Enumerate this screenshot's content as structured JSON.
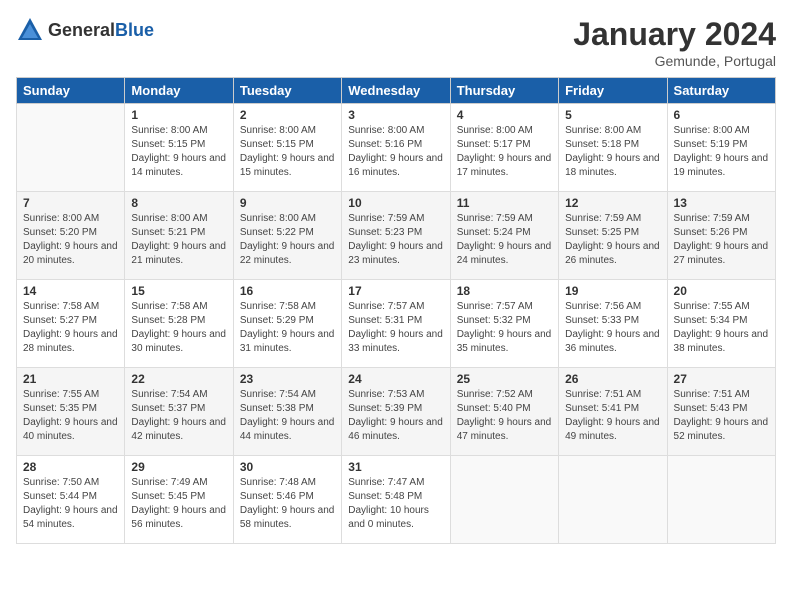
{
  "logo": {
    "general": "General",
    "blue": "Blue"
  },
  "title": "January 2024",
  "location": "Gemunde, Portugal",
  "days_of_week": [
    "Sunday",
    "Monday",
    "Tuesday",
    "Wednesday",
    "Thursday",
    "Friday",
    "Saturday"
  ],
  "weeks": [
    [
      {
        "num": "",
        "sunrise": "",
        "sunset": "",
        "daylight": ""
      },
      {
        "num": "1",
        "sunrise": "Sunrise: 8:00 AM",
        "sunset": "Sunset: 5:15 PM",
        "daylight": "Daylight: 9 hours and 14 minutes."
      },
      {
        "num": "2",
        "sunrise": "Sunrise: 8:00 AM",
        "sunset": "Sunset: 5:15 PM",
        "daylight": "Daylight: 9 hours and 15 minutes."
      },
      {
        "num": "3",
        "sunrise": "Sunrise: 8:00 AM",
        "sunset": "Sunset: 5:16 PM",
        "daylight": "Daylight: 9 hours and 16 minutes."
      },
      {
        "num": "4",
        "sunrise": "Sunrise: 8:00 AM",
        "sunset": "Sunset: 5:17 PM",
        "daylight": "Daylight: 9 hours and 17 minutes."
      },
      {
        "num": "5",
        "sunrise": "Sunrise: 8:00 AM",
        "sunset": "Sunset: 5:18 PM",
        "daylight": "Daylight: 9 hours and 18 minutes."
      },
      {
        "num": "6",
        "sunrise": "Sunrise: 8:00 AM",
        "sunset": "Sunset: 5:19 PM",
        "daylight": "Daylight: 9 hours and 19 minutes."
      }
    ],
    [
      {
        "num": "7",
        "sunrise": "Sunrise: 8:00 AM",
        "sunset": "Sunset: 5:20 PM",
        "daylight": "Daylight: 9 hours and 20 minutes."
      },
      {
        "num": "8",
        "sunrise": "Sunrise: 8:00 AM",
        "sunset": "Sunset: 5:21 PM",
        "daylight": "Daylight: 9 hours and 21 minutes."
      },
      {
        "num": "9",
        "sunrise": "Sunrise: 8:00 AM",
        "sunset": "Sunset: 5:22 PM",
        "daylight": "Daylight: 9 hours and 22 minutes."
      },
      {
        "num": "10",
        "sunrise": "Sunrise: 7:59 AM",
        "sunset": "Sunset: 5:23 PM",
        "daylight": "Daylight: 9 hours and 23 minutes."
      },
      {
        "num": "11",
        "sunrise": "Sunrise: 7:59 AM",
        "sunset": "Sunset: 5:24 PM",
        "daylight": "Daylight: 9 hours and 24 minutes."
      },
      {
        "num": "12",
        "sunrise": "Sunrise: 7:59 AM",
        "sunset": "Sunset: 5:25 PM",
        "daylight": "Daylight: 9 hours and 26 minutes."
      },
      {
        "num": "13",
        "sunrise": "Sunrise: 7:59 AM",
        "sunset": "Sunset: 5:26 PM",
        "daylight": "Daylight: 9 hours and 27 minutes."
      }
    ],
    [
      {
        "num": "14",
        "sunrise": "Sunrise: 7:58 AM",
        "sunset": "Sunset: 5:27 PM",
        "daylight": "Daylight: 9 hours and 28 minutes."
      },
      {
        "num": "15",
        "sunrise": "Sunrise: 7:58 AM",
        "sunset": "Sunset: 5:28 PM",
        "daylight": "Daylight: 9 hours and 30 minutes."
      },
      {
        "num": "16",
        "sunrise": "Sunrise: 7:58 AM",
        "sunset": "Sunset: 5:29 PM",
        "daylight": "Daylight: 9 hours and 31 minutes."
      },
      {
        "num": "17",
        "sunrise": "Sunrise: 7:57 AM",
        "sunset": "Sunset: 5:31 PM",
        "daylight": "Daylight: 9 hours and 33 minutes."
      },
      {
        "num": "18",
        "sunrise": "Sunrise: 7:57 AM",
        "sunset": "Sunset: 5:32 PM",
        "daylight": "Daylight: 9 hours and 35 minutes."
      },
      {
        "num": "19",
        "sunrise": "Sunrise: 7:56 AM",
        "sunset": "Sunset: 5:33 PM",
        "daylight": "Daylight: 9 hours and 36 minutes."
      },
      {
        "num": "20",
        "sunrise": "Sunrise: 7:55 AM",
        "sunset": "Sunset: 5:34 PM",
        "daylight": "Daylight: 9 hours and 38 minutes."
      }
    ],
    [
      {
        "num": "21",
        "sunrise": "Sunrise: 7:55 AM",
        "sunset": "Sunset: 5:35 PM",
        "daylight": "Daylight: 9 hours and 40 minutes."
      },
      {
        "num": "22",
        "sunrise": "Sunrise: 7:54 AM",
        "sunset": "Sunset: 5:37 PM",
        "daylight": "Daylight: 9 hours and 42 minutes."
      },
      {
        "num": "23",
        "sunrise": "Sunrise: 7:54 AM",
        "sunset": "Sunset: 5:38 PM",
        "daylight": "Daylight: 9 hours and 44 minutes."
      },
      {
        "num": "24",
        "sunrise": "Sunrise: 7:53 AM",
        "sunset": "Sunset: 5:39 PM",
        "daylight": "Daylight: 9 hours and 46 minutes."
      },
      {
        "num": "25",
        "sunrise": "Sunrise: 7:52 AM",
        "sunset": "Sunset: 5:40 PM",
        "daylight": "Daylight: 9 hours and 47 minutes."
      },
      {
        "num": "26",
        "sunrise": "Sunrise: 7:51 AM",
        "sunset": "Sunset: 5:41 PM",
        "daylight": "Daylight: 9 hours and 49 minutes."
      },
      {
        "num": "27",
        "sunrise": "Sunrise: 7:51 AM",
        "sunset": "Sunset: 5:43 PM",
        "daylight": "Daylight: 9 hours and 52 minutes."
      }
    ],
    [
      {
        "num": "28",
        "sunrise": "Sunrise: 7:50 AM",
        "sunset": "Sunset: 5:44 PM",
        "daylight": "Daylight: 9 hours and 54 minutes."
      },
      {
        "num": "29",
        "sunrise": "Sunrise: 7:49 AM",
        "sunset": "Sunset: 5:45 PM",
        "daylight": "Daylight: 9 hours and 56 minutes."
      },
      {
        "num": "30",
        "sunrise": "Sunrise: 7:48 AM",
        "sunset": "Sunset: 5:46 PM",
        "daylight": "Daylight: 9 hours and 58 minutes."
      },
      {
        "num": "31",
        "sunrise": "Sunrise: 7:47 AM",
        "sunset": "Sunset: 5:48 PM",
        "daylight": "Daylight: 10 hours and 0 minutes."
      },
      {
        "num": "",
        "sunrise": "",
        "sunset": "",
        "daylight": ""
      },
      {
        "num": "",
        "sunrise": "",
        "sunset": "",
        "daylight": ""
      },
      {
        "num": "",
        "sunrise": "",
        "sunset": "",
        "daylight": ""
      }
    ]
  ]
}
